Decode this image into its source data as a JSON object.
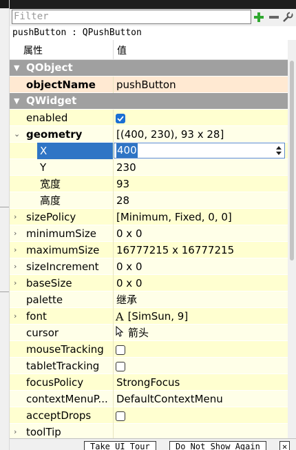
{
  "filter": {
    "placeholder": "Filter"
  },
  "toolbar": {
    "add_icon": "plus-icon",
    "remove_icon": "minus-icon",
    "config_icon": "wrench-icon"
  },
  "object_label": "pushButton : QPushButton",
  "header": {
    "col_property": "属性",
    "col_value": "值"
  },
  "rows": [
    {
      "kind": "section",
      "name": "QObject"
    },
    {
      "kind": "prop",
      "name": "objectName",
      "value": "pushButton"
    },
    {
      "kind": "section",
      "name": "QWidget"
    },
    {
      "kind": "prop",
      "name": "enabled",
      "checked": true
    },
    {
      "kind": "prop",
      "name": "geometry",
      "value": "[(400, 230), 93 x 28]"
    },
    {
      "kind": "prop",
      "name": "X",
      "value": "400"
    },
    {
      "kind": "prop",
      "name": "Y",
      "value": "230"
    },
    {
      "kind": "prop",
      "name": "宽度",
      "value": "93"
    },
    {
      "kind": "prop",
      "name": "高度",
      "value": "28"
    },
    {
      "kind": "prop",
      "name": "sizePolicy",
      "value": "[Minimum, Fixed, 0, 0]"
    },
    {
      "kind": "prop",
      "name": "minimumSize",
      "value": "0 x 0"
    },
    {
      "kind": "prop",
      "name": "maximumSize",
      "value": "16777215 x 16777215"
    },
    {
      "kind": "prop",
      "name": "sizeIncrement",
      "value": "0 x 0"
    },
    {
      "kind": "prop",
      "name": "baseSize",
      "value": "0 x 0"
    },
    {
      "kind": "prop",
      "name": "palette",
      "value": "继承"
    },
    {
      "kind": "prop",
      "name": "font",
      "value": "[SimSun, 9]",
      "icon_glyph": "A"
    },
    {
      "kind": "prop",
      "name": "cursor",
      "value": "箭头",
      "icon": "arrow-cursor-icon"
    },
    {
      "kind": "prop",
      "name": "mouseTracking",
      "checked": false
    },
    {
      "kind": "prop",
      "name": "tabletTracking",
      "checked": false
    },
    {
      "kind": "prop",
      "name": "focusPolicy",
      "value": "StrongFocus"
    },
    {
      "kind": "prop",
      "name": "contextMenuP...",
      "value": "DefaultContextMenu"
    },
    {
      "kind": "prop",
      "name": "acceptDrops",
      "checked": false
    },
    {
      "kind": "prop",
      "name": "toolTip",
      "value": ""
    }
  ],
  "bottom_buttons": {
    "tour": "Take UI Tour",
    "dont_show": "Do Not Show Again",
    "close": "✕"
  }
}
